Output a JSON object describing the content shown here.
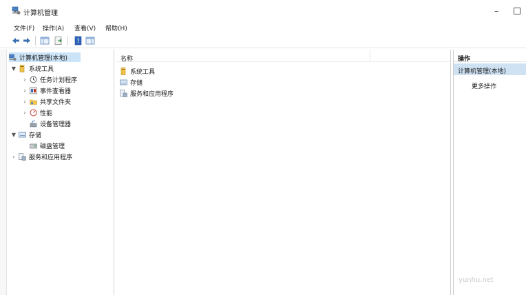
{
  "window": {
    "title": "计算机管理"
  },
  "menu": [
    {
      "label": "文件(F)"
    },
    {
      "label": "操作(A)"
    },
    {
      "label": "查看(V)"
    },
    {
      "label": "帮助(H)"
    }
  ],
  "tree": {
    "root": "计算机管理(本地)",
    "system_tools": "系统工具",
    "task_scheduler": "任务计划程序",
    "event_viewer": "事件查看器",
    "shared_folders": "共享文件夹",
    "performance": "性能",
    "device_manager": "设备管理器",
    "storage": "存储",
    "disk_management": "磁盘管理",
    "services_apps": "服务和应用程序"
  },
  "list": {
    "column_name": "名称",
    "items": [
      {
        "label": "系统工具"
      },
      {
        "label": "存储"
      },
      {
        "label": "服务和应用程序"
      }
    ]
  },
  "actions": {
    "header": "操作",
    "section": "计算机管理(本地)",
    "more": "更多操作"
  },
  "watermark": "yunhu.net"
}
